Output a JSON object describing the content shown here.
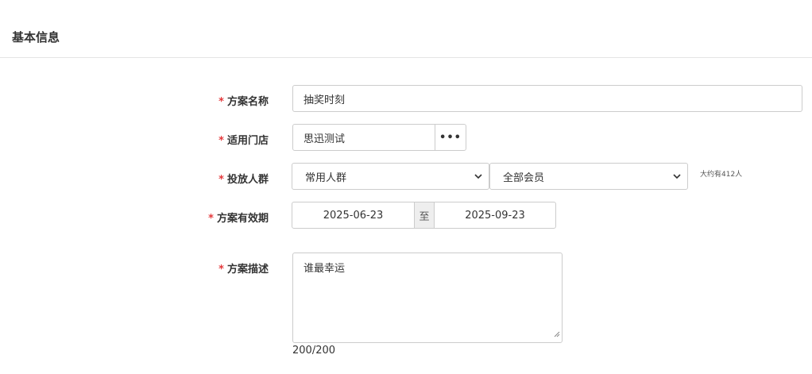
{
  "section": {
    "title": "基本信息"
  },
  "form": {
    "required_mark": "*",
    "plan_name": {
      "label": "方案名称",
      "value": "抽奖时刻"
    },
    "store": {
      "label": "适用门店",
      "value": "思迅测试",
      "more_label": "•••"
    },
    "audience": {
      "label": "投放人群",
      "select1": "常用人群",
      "select2": "全部会员",
      "hint": "大约有412人"
    },
    "validity": {
      "label": "方案有效期",
      "start": "2025-06-23",
      "separator": "至",
      "end": "2025-09-23"
    },
    "description": {
      "label": "方案描述",
      "value": "谁最幸运",
      "counter": "200/200"
    }
  },
  "icons": {
    "select_arrow": "chevron-down-icon",
    "resize": "resize-handle-icon",
    "more": "ellipsis-icon"
  },
  "colors": {
    "required": "#e4393c",
    "border": "#cccccc",
    "separator_bg": "#eeeeee"
  }
}
